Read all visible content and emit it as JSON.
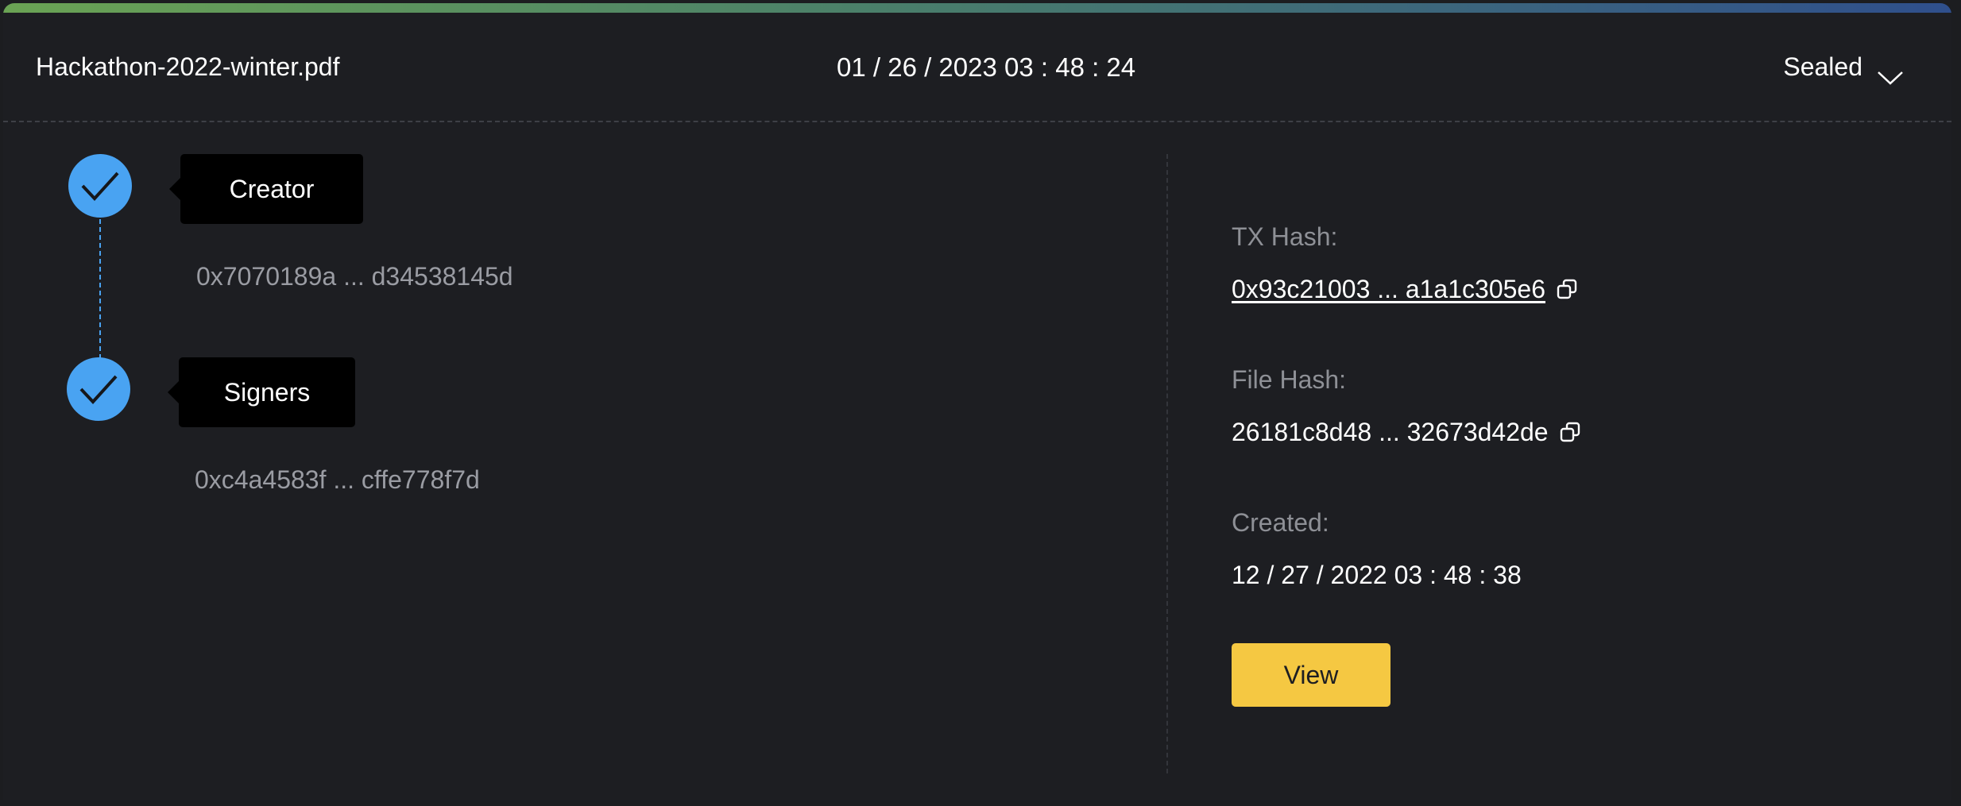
{
  "header": {
    "file_name": "Hackathon-2022-winter.pdf",
    "date": "01 / 26 / 2023 03 : 48 : 24",
    "status": "Sealed",
    "status_icon": "chevron-down-icon"
  },
  "steps": [
    {
      "label": "Creator",
      "address": "0x7070189a ... d34538145d",
      "done": true,
      "icon": "check-icon"
    },
    {
      "label": "Signers",
      "address": "0xc4a4583f ... cffe778f7d",
      "done": true,
      "icon": "check-icon"
    }
  ],
  "details": {
    "tx_hash_label": "TX Hash:",
    "tx_hash_value": "0x93c21003 ... a1a1c305e6",
    "file_hash_label": "File Hash:",
    "file_hash_value": "26181c8d48 ... 32673d42de",
    "created_label": "Created:",
    "created_value": "12 / 27 / 2022 03 : 48 : 38",
    "copy_icon": "copy-icon",
    "view_button": "View"
  },
  "colors": {
    "background": "#1d1e22",
    "step_accent": "#49a3f2",
    "button": "#f5c842",
    "gradient": [
      "#6aa354",
      "#2f4f8c"
    ]
  }
}
